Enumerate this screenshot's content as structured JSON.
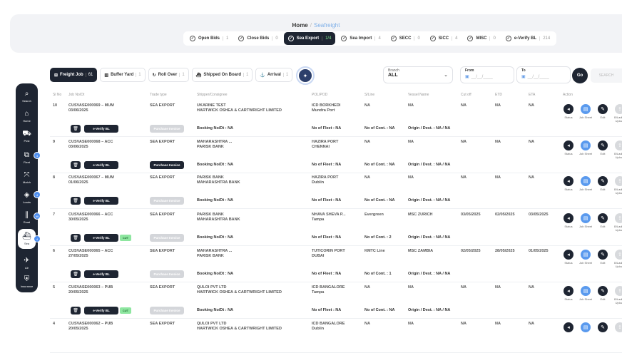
{
  "breadcrumb": {
    "home": "Home",
    "sep": "/",
    "current": "Seafreight"
  },
  "tabs": [
    {
      "label": "Open Bids",
      "count": "1",
      "active": false
    },
    {
      "label": "Close Bids",
      "count": "0",
      "active": false
    },
    {
      "label": "Sea Export",
      "count": "1/4",
      "active": true
    },
    {
      "label": "Sea Import",
      "count": "4",
      "active": false
    },
    {
      "label": "SECC",
      "count": "0",
      "active": false
    },
    {
      "label": "SICC",
      "count": "4",
      "active": false
    },
    {
      "label": "MISC",
      "count": "0",
      "active": false
    },
    {
      "label": "e-Verify BL",
      "count": "214",
      "active": false
    }
  ],
  "sidebar": {
    "items": [
      {
        "label": "Search",
        "glyph": "⌕",
        "icon": "search-icon"
      },
      {
        "label": "Home",
        "glyph": "⌂",
        "icon": "home-icon"
      },
      {
        "label": "Post",
        "glyph": "⛟",
        "icon": "truck-icon"
      },
      {
        "label": "Fleet",
        "glyph": "⧉",
        "icon": "fleet-icon"
      },
      {
        "label": "Match",
        "glyph": "⤧",
        "icon": "match-icon"
      },
      {
        "label": "Loads",
        "glyph": "◈",
        "icon": "tag-icon"
      },
      {
        "label": "Road",
        "glyph": "∥",
        "icon": "road-icon"
      },
      {
        "label": "Sea",
        "glyph": "⛴",
        "icon": "ship-icon"
      },
      {
        "label": "Air",
        "glyph": "✈",
        "icon": "plane-icon"
      },
      {
        "label": "Insurance",
        "glyph": "⛨",
        "icon": "shield-icon"
      }
    ],
    "badges": [
      "4",
      "4",
      "99",
      "4"
    ]
  },
  "filters": [
    {
      "label": "Freight Job",
      "count": "61",
      "glyph": "⊞",
      "active": true
    },
    {
      "label": "Buffer Yard",
      "count": "1",
      "glyph": "▥",
      "active": false
    },
    {
      "label": "Roll Over",
      "count": "1",
      "glyph": "↻",
      "active": false
    },
    {
      "label": "Shipped On Board",
      "count": "1",
      "glyph": "⛴",
      "active": false
    },
    {
      "label": "Arrival",
      "count": "1",
      "glyph": "⚓",
      "active": false
    }
  ],
  "user_initials": "✦",
  "branch": {
    "label": "Branch",
    "value": "ALL"
  },
  "from": {
    "label": "From",
    "placeholder": "__/__/____"
  },
  "to": {
    "label": "To",
    "placeholder": "__/__/____"
  },
  "go_label": "Go",
  "search_label": "SEARCH",
  "columns": [
    "Sl No",
    "Job No/Dt",
    "Trade type",
    "Shipper/Consignee",
    "POL/POD",
    "S/Line",
    "Vessel Name",
    "Cut off",
    "ETD",
    "ETA",
    "Action"
  ],
  "action_labels": {
    "status": "Status",
    "job_sheet": "Job Sheet",
    "edit": "Edit",
    "upload": "B/Lading Upload"
  },
  "everify_label": "e-Verify BL",
  "purchase_label": "Purchase Invoice",
  "rows": [
    {
      "sl": "10",
      "job": "CUSVASE000069 – MUM",
      "date": "03/06/2025",
      "trade": "SEA EXPORT",
      "shipper": "UKARINE TEST",
      "consignee": "HARTWICK OSHEA & CARTWRIGHT LIMITED",
      "pol": "ICD BORKHEDI",
      "pod": "Mundra Port",
      "sline": "NA",
      "vessel": "NA",
      "cutoff": "NA",
      "etd": "NA",
      "eta": "NA",
      "booking": "Booking No/Dt : NA",
      "fleet": "No of Fleet : NA",
      "cont": "No of Cont. : NA",
      "origin": "Origin / Dest. : NA / NA",
      "badge": "",
      "pi_dark": false
    },
    {
      "sl": "9",
      "job": "CUSVASE000068 – ACC",
      "date": "03/06/2025",
      "trade": "SEA EXPORT",
      "shipper": "MAHARASHTRA ...",
      "consignee": "PARISK BANK",
      "pol": "HAZIRA PORT",
      "pod": "CHENNAI",
      "sline": "NA",
      "vessel": "NA",
      "cutoff": "NA",
      "etd": "NA",
      "eta": "NA",
      "booking": "Booking No/Dt : NA",
      "fleet": "No of Fleet : NA",
      "cont": "No of Cont. : NA",
      "origin": "Origin / Dest. : NA / NA",
      "badge": "",
      "pi_dark": true
    },
    {
      "sl": "8",
      "job": "CUSVASE000067 – MUM",
      "date": "01/06/2025",
      "trade": "SEA EXPORT",
      "shipper": "PARISK BANK",
      "consignee": "MAHARASHTRA BANK",
      "pol": "HAZIRA PORT",
      "pod": "Dublin",
      "sline": "NA",
      "vessel": "NA",
      "cutoff": "NA",
      "etd": "NA",
      "eta": "NA",
      "booking": "Booking No/Dt : NA",
      "fleet": "No of Fleet : NA",
      "cont": "No of Cont. : NA",
      "origin": "Origin / Dest. : NA / NA",
      "badge": "",
      "pi_dark": false
    },
    {
      "sl": "7",
      "job": "CUSVASE000066 – ACC",
      "date": "30/05/2025",
      "trade": "SEA EXPORT",
      "shipper": "PARISK BANK",
      "consignee": "MAHARASHTRA BANK",
      "pol": "NHAVA SHEVA P...",
      "pod": "Tampa",
      "sline": "Evergreen",
      "vessel": "MSC ZURICH",
      "cutoff": "03/05/2025",
      "etd": "02/05/2025",
      "eta": "03/05/2025",
      "booking": "Booking No/Dt : NA",
      "fleet": "No of Fleet : NA",
      "cont": "No of Cont. : 2",
      "origin": "Origin / Dest. : NA / NA",
      "badge": "CUT",
      "pi_dark": false
    },
    {
      "sl": "6",
      "job": "CUSVASE000065 – ACC",
      "date": "27/05/2025",
      "trade": "SEA EXPORT",
      "shipper": "MAHARASHTRA ...",
      "consignee": "PARISK BANK",
      "pol": "TUTICORIN PORT",
      "pod": "DUBAI",
      "sline": "KMTC Line",
      "vessel": "MSC ZAMBIA",
      "cutoff": "02/05/2025",
      "etd": "28/05/2025",
      "eta": "01/05/2025",
      "booking": "Booking No/Dt : NA",
      "fleet": "No of Fleet : NA",
      "cont": "No of Cont. : 1",
      "origin": "Origin / Dest. : NA / NA",
      "badge": "",
      "pi_dark": false
    },
    {
      "sl": "5",
      "job": "CUSVASE000063 – PUB",
      "date": "20/05/2025",
      "trade": "SEA EXPORT",
      "shipper": "QULOI PVT LTD",
      "consignee": "HARTWICK OSHEA & CARTWRIGHT LIMITED",
      "pol": "ICD BANGALORE",
      "pod": "Tampa",
      "sline": "NA",
      "vessel": "NA",
      "cutoff": "NA",
      "etd": "NA",
      "eta": "NA",
      "booking": "Booking No/Dt : NA",
      "fleet": "No of Fleet : NA",
      "cont": "No of Cont. : NA",
      "origin": "Origin / Dest. : NA / NA",
      "badge": "CUT",
      "pi_dark": false
    },
    {
      "sl": "4",
      "job": "CUSVASE000062 – PUB",
      "date": "20/05/2025",
      "trade": "SEA EXPORT",
      "shipper": "QULOI PVT LTD",
      "consignee": "HARTWICK OSHEA & CARTWRIGHT LIMITED",
      "pol": "ICD BANGALORE",
      "pod": "Dublin",
      "sline": "NA",
      "vessel": "NA",
      "cutoff": "NA",
      "etd": "NA",
      "eta": "NA",
      "booking": "",
      "fleet": "",
      "cont": "",
      "origin": "",
      "badge": "",
      "pi_dark": false
    }
  ]
}
